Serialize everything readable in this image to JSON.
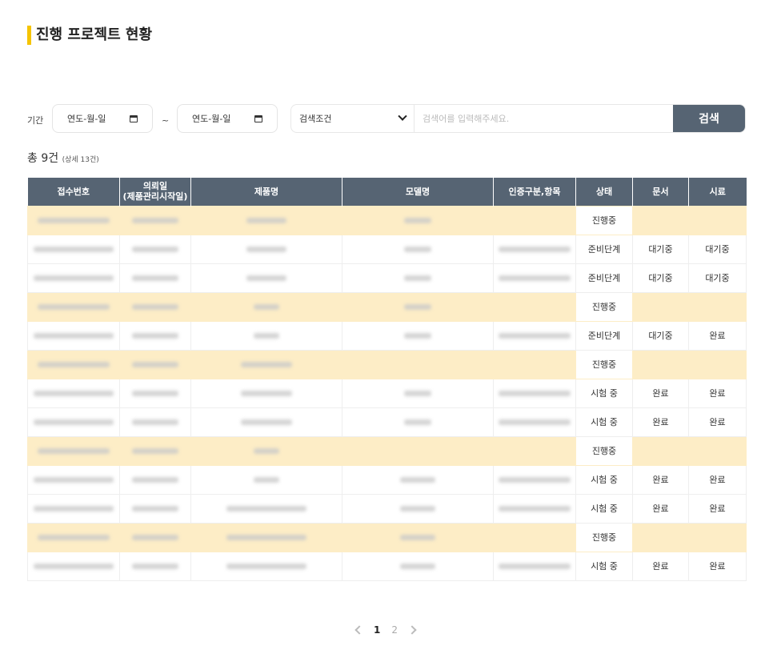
{
  "title": "진행 프로젝트 현황",
  "filter": {
    "period_label": "기간",
    "date_placeholder": "연도-월-일",
    "tilde": "~",
    "condition": "검색조건",
    "search_placeholder": "검색어를 입력해주세요.",
    "search_button": "검색"
  },
  "summary": {
    "total": "총 9건",
    "detail": "(상세 13건)"
  },
  "table": {
    "headers": [
      "접수번호",
      "의뢰일\n(제품관리시작일)",
      "제품명",
      "모델명",
      "인증구분,항목",
      "상태",
      "문서",
      "시료"
    ],
    "rows": [
      {
        "hl": true,
        "model": true,
        "cert": false,
        "status": "진행중",
        "doc": "",
        "sample": ""
      },
      {
        "hl": false,
        "model": true,
        "cert": true,
        "status": "준비단계",
        "doc": "대기중",
        "sample": "대기중"
      },
      {
        "hl": false,
        "model": true,
        "cert": true,
        "status": "준비단계",
        "doc": "대기중",
        "sample": "대기중"
      },
      {
        "hl": true,
        "model": true,
        "cert": false,
        "status": "진행중",
        "doc": "",
        "sample": ""
      },
      {
        "hl": false,
        "model": true,
        "cert": true,
        "status": "준비단계",
        "doc": "대기중",
        "sample": "완료"
      },
      {
        "hl": true,
        "model": false,
        "cert": false,
        "status": "진행중",
        "doc": "",
        "sample": ""
      },
      {
        "hl": false,
        "model": true,
        "cert": true,
        "status": "시험 중",
        "doc": "완료",
        "sample": "완료"
      },
      {
        "hl": false,
        "model": true,
        "cert": true,
        "status": "시험 중",
        "doc": "완료",
        "sample": "완료"
      },
      {
        "hl": true,
        "model": false,
        "cert": false,
        "status": "진행중",
        "doc": "",
        "sample": ""
      },
      {
        "hl": false,
        "model": true,
        "cert": true,
        "status": "시험 중",
        "doc": "완료",
        "sample": "완료"
      },
      {
        "hl": false,
        "model": true,
        "cert": true,
        "status": "시험 중",
        "doc": "완료",
        "sample": "완료"
      },
      {
        "hl": true,
        "model": true,
        "cert": false,
        "status": "진행중",
        "doc": "",
        "sample": ""
      },
      {
        "hl": false,
        "model": true,
        "cert": true,
        "status": "시험 중",
        "doc": "완료",
        "sample": "완료"
      }
    ]
  },
  "pagination": {
    "pages": [
      "1",
      "2"
    ],
    "current": "1"
  }
}
